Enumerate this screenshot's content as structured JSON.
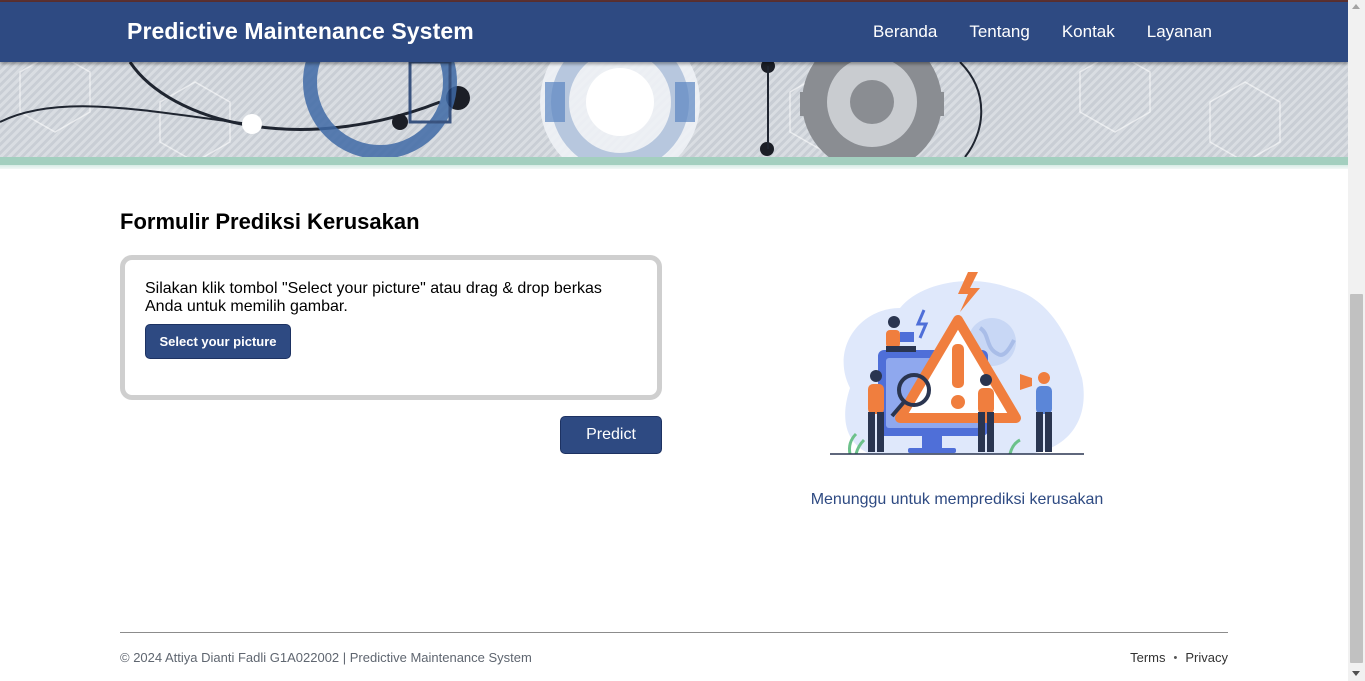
{
  "header": {
    "brand": "Predictive Maintenance System",
    "nav": [
      "Beranda",
      "Tentang",
      "Kontak",
      "Layanan"
    ],
    "color": "#2e4a82"
  },
  "form": {
    "title": "Formulir Prediksi Kerusakan",
    "instruction": "Silakan klik tombol \"Select your picture\" atau drag & drop berkas Anda untuk memilih gambar.",
    "select_button": "Select your picture",
    "predict_button": "Predict"
  },
  "result": {
    "illustration_icon": "warning-alert-illustration",
    "status": "Menunggu untuk memprediksi kerusakan"
  },
  "footer": {
    "copyright": "© 2024 Attiya Dianti Fadli G1A022002 | Predictive Maintenance System",
    "links": [
      "Terms",
      "Privacy"
    ],
    "separator": "•"
  }
}
